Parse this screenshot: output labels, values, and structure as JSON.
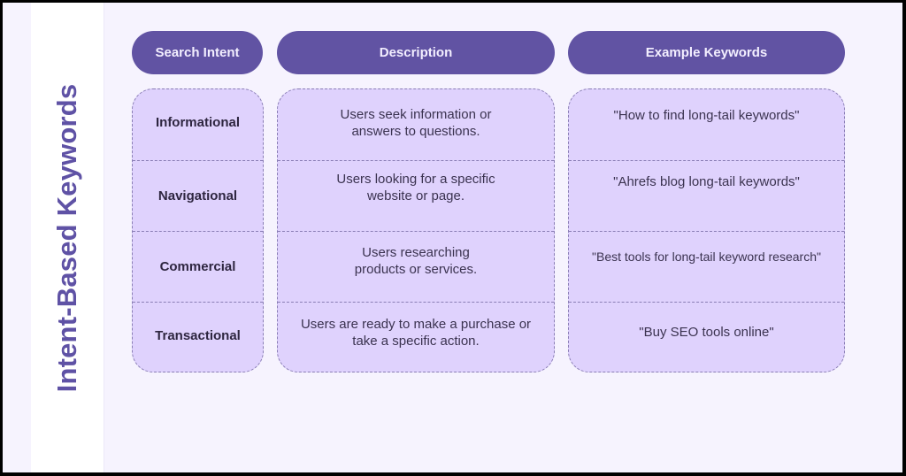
{
  "title": "Intent-Based Keywords",
  "colors": {
    "header_bg": "#6153a3",
    "cell_bg": "#dfd2fd",
    "title_color": "#5f52a5",
    "page_bg": "#f6f3fe"
  },
  "headers": [
    "Search Intent",
    "Description",
    "Example Keywords"
  ],
  "rows": [
    {
      "intent": "Informational",
      "description": "Users seek information or answers to questions.",
      "example": "\"How to find long-tail keywords\""
    },
    {
      "intent": "Navigational",
      "description": "Users looking for a specific website or page.",
      "example": "\"Ahrefs blog long-tail keywords\""
    },
    {
      "intent": "Commercial",
      "description": "Users researching products or services.",
      "example": "\"Best tools for long-tail keyword research\""
    },
    {
      "intent": "Transactional",
      "description": "Users are ready to make a purchase or take a specific action.",
      "example": "\"Buy SEO tools online\""
    }
  ]
}
